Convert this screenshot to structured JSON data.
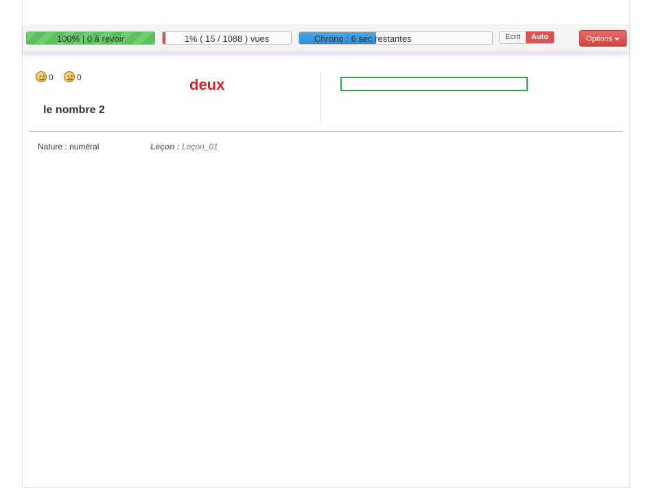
{
  "toolbar": {
    "review_status": "100%  |  0 à revoir",
    "seen_progress_text": "1% ( 15 / 1088 ) vues",
    "seen_progress_fraction": 0.01,
    "chrono_text": "Chrono : 6 sec restantes",
    "chrono_fraction": 0.4,
    "mode_options": [
      "Ecrit",
      "Auto"
    ],
    "mode_selected": "Auto",
    "options_label": "Options"
  },
  "scores": {
    "happy_icon": "happy-smiley-icon",
    "happy_count": "0",
    "sad_icon": "sad-smiley-icon",
    "sad_count": "0"
  },
  "card": {
    "word": "deux",
    "translation": "le nombre 2",
    "answer_value": ""
  },
  "details": {
    "nature": "Nature : numéral",
    "lecon_label": "Leçon :",
    "lecon_value": "Leçon_01"
  },
  "colors": {
    "accent_red": "#d9534f",
    "word_red": "#e02020",
    "success_green": "#5cbf5c",
    "input_border_green": "#2ea84a",
    "chrono_blue": "#2f8ed6"
  }
}
